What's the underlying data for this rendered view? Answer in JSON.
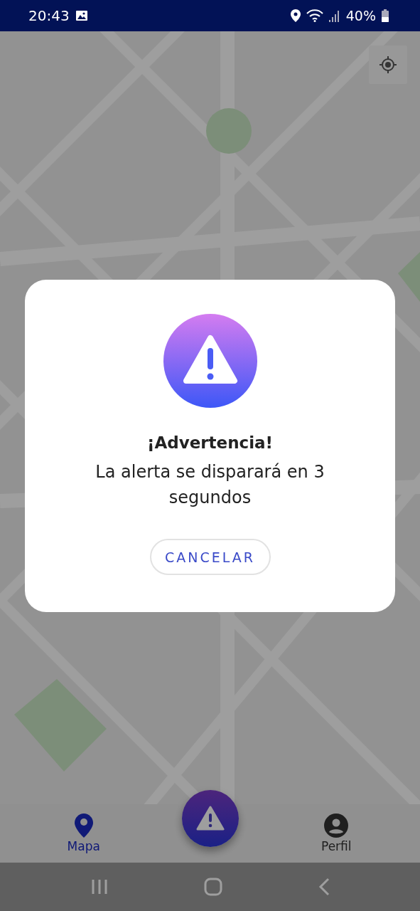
{
  "status_bar": {
    "time": "20:43",
    "battery": "40%"
  },
  "dialog": {
    "title": "¡Advertencia!",
    "message": "La alerta se disparará en 3 segundos",
    "button": "CANCELAR"
  },
  "bottom_nav": {
    "items": [
      {
        "kind": "map",
        "label": "Mapa",
        "selected": true
      },
      {
        "kind": "alert",
        "selected": false
      },
      {
        "kind": "profile",
        "label": "Perfil",
        "selected": false
      }
    ]
  }
}
